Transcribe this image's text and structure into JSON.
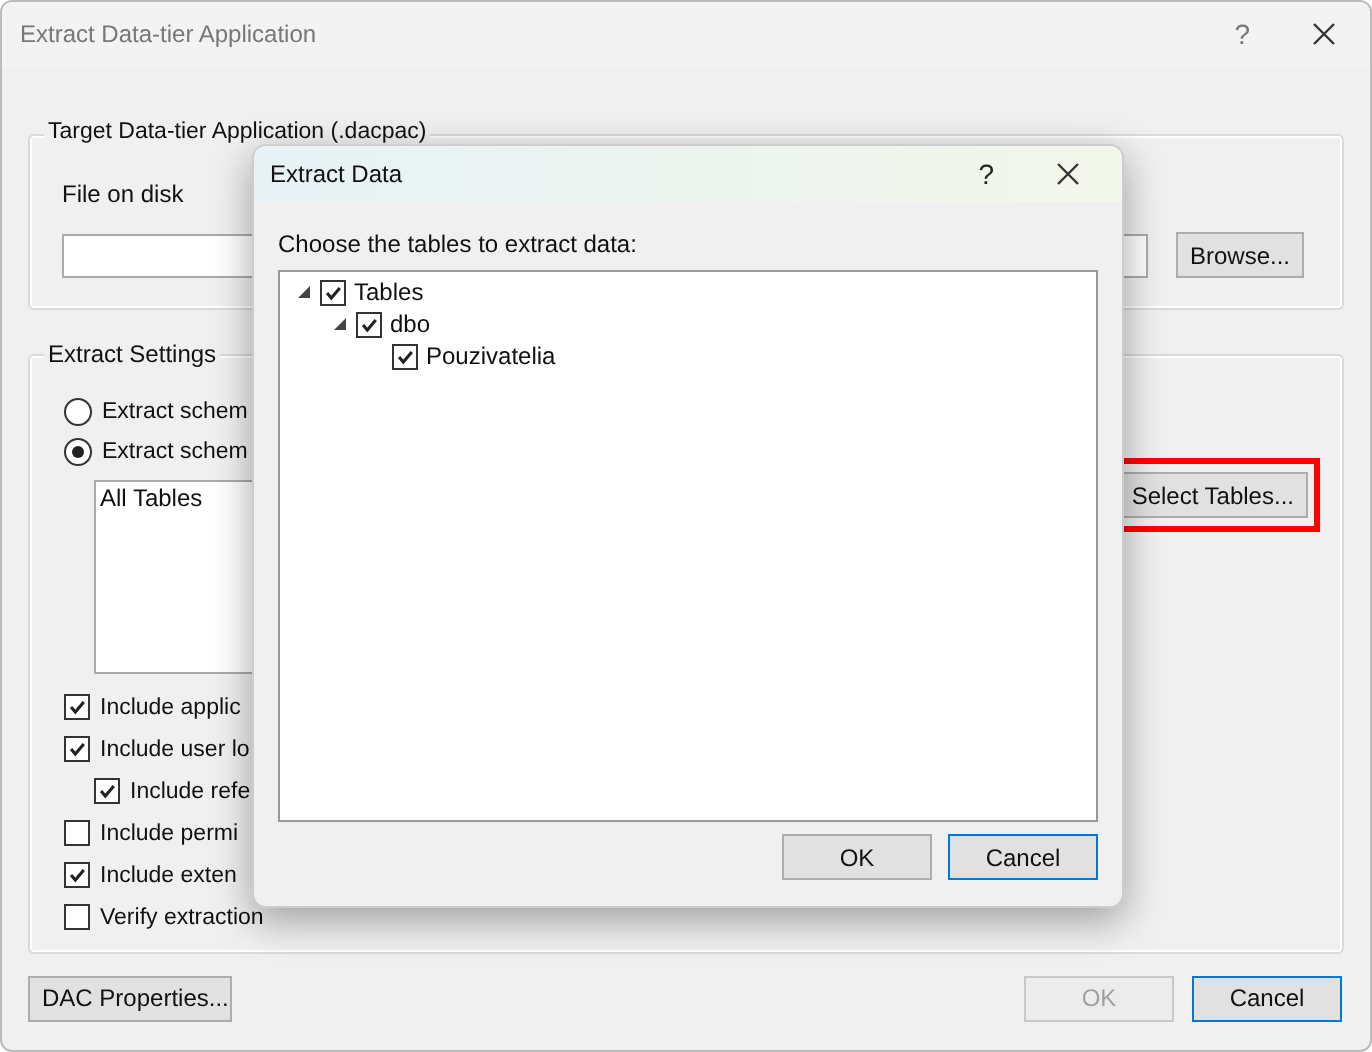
{
  "window": {
    "title": "Extract Data-tier Application",
    "help": "?"
  },
  "target_group": {
    "title": "Target Data-tier Application (.dacpac)",
    "file_label": "File on disk",
    "browse_button": "Browse..."
  },
  "extract_settings": {
    "title": "Extract Settings",
    "options": [
      {
        "label": "Extract schem",
        "selected": false
      },
      {
        "label": "Extract schem",
        "selected": true
      }
    ],
    "tables_list": [
      "All Tables"
    ],
    "select_tables_button": {
      "label": "Select Tables...",
      "highlighted": true
    },
    "checkboxes": [
      {
        "label": "Include applic",
        "checked": true
      },
      {
        "label": "Include user lo",
        "checked": true,
        "children": [
          {
            "label": "Include refe",
            "checked": true
          }
        ]
      },
      {
        "label": "Include permi",
        "checked": false
      },
      {
        "label": "Include exten",
        "checked": true
      },
      {
        "label": "Verify extraction",
        "checked": false
      }
    ]
  },
  "footer": {
    "dac_properties_button": "DAC Properties...",
    "buttons": [
      {
        "label": "OK",
        "disabled": true,
        "focused": false
      },
      {
        "label": "Cancel",
        "disabled": false,
        "focused": true
      }
    ]
  },
  "dialog": {
    "title": "Extract Data",
    "help": "?",
    "prompt": "Choose the tables to extract data:",
    "tree": [
      {
        "label": "Tables",
        "checked": true,
        "expanded": true,
        "children": [
          {
            "label": "dbo",
            "checked": true,
            "expanded": true,
            "children": [
              {
                "label": "Pouzivatelia",
                "checked": true
              }
            ]
          }
        ]
      }
    ],
    "buttons": [
      {
        "label": "OK",
        "disabled": false,
        "focused": false
      },
      {
        "label": "Cancel",
        "disabled": false,
        "focused": true
      }
    ]
  }
}
